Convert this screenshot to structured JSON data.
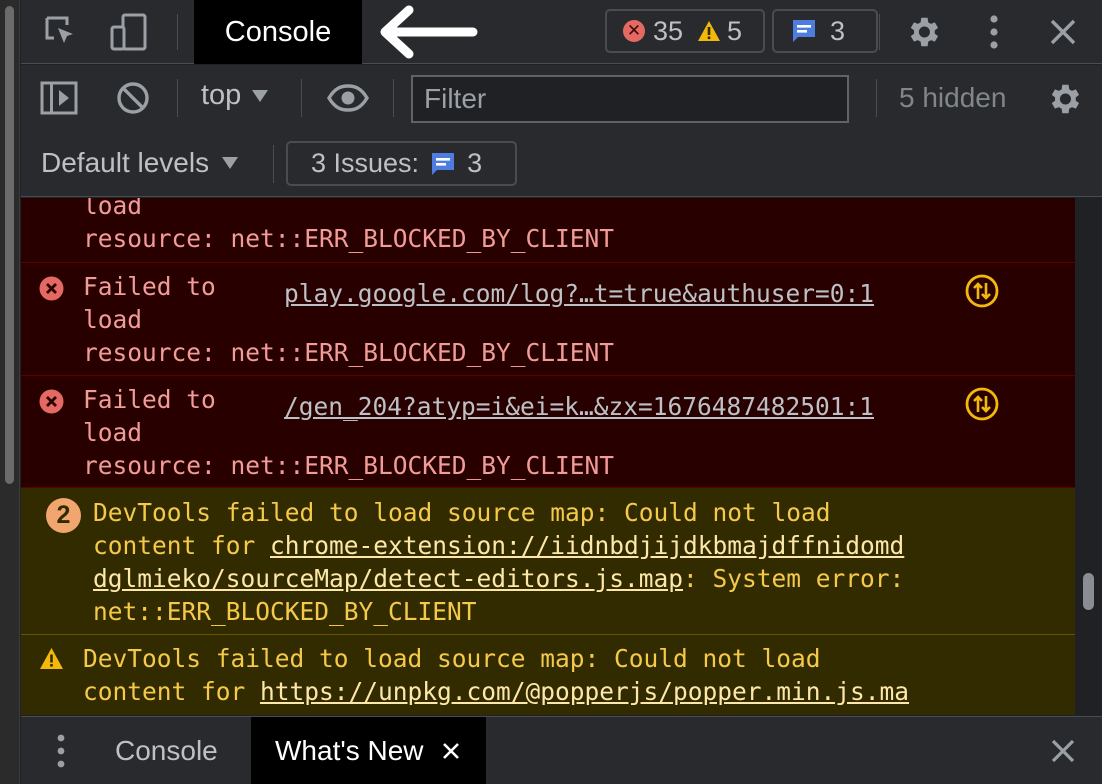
{
  "topbar": {
    "active_tab": "Console",
    "error_count": "35",
    "warning_count": "5",
    "message_count": "3"
  },
  "toolbar": {
    "context": "top",
    "filter_placeholder": "Filter",
    "hidden": "5 hidden",
    "levels": "Default levels",
    "issues_label": "3 Issues:",
    "issues_count": "3"
  },
  "log": {
    "partial_error": {
      "line1": "load",
      "line2": "resource: net::ERR_BLOCKED_BY_CLIENT"
    },
    "errors": [
      {
        "line1": "Failed to",
        "line2": "load",
        "line3": "resource: net::ERR_BLOCKED_BY_CLIENT",
        "source": "play.google.com/log?…t=true&authuser=0:1"
      },
      {
        "line1": "Failed to",
        "line2": "load",
        "line3": "resource: net::ERR_BLOCKED_BY_CLIENT",
        "source": "/gen_204?atyp=i&ei=k…&zx=1676487482501:1"
      }
    ],
    "warning_grouped": {
      "repeat_count": "2",
      "line1": "DevTools failed to load source map: Could not load",
      "line2_prefix": "content for ",
      "link_part1": "chrome-extension://iidnbdjijdkbmajdffnidomd",
      "link_part2": "dglmieko/sourceMap/detect-editors.js.map",
      "line3_suffix": ": System error:",
      "line4": "net::ERR_BLOCKED_BY_CLIENT"
    },
    "warning_single": {
      "line1": "DevTools failed to load source map: Could not load",
      "line2_prefix": "content for ",
      "link": "https://unpkg.com/@popperjs/popper.min.js.ma"
    }
  },
  "drawer": {
    "tab_console": "Console",
    "tab_whats_new": "What's New"
  },
  "colors": {
    "error_bg": "#290000",
    "error_text": "#f29c99",
    "warning_bg": "#332b00",
    "warning_text": "#f5c94a",
    "message_blue": "#4e7ddf"
  }
}
